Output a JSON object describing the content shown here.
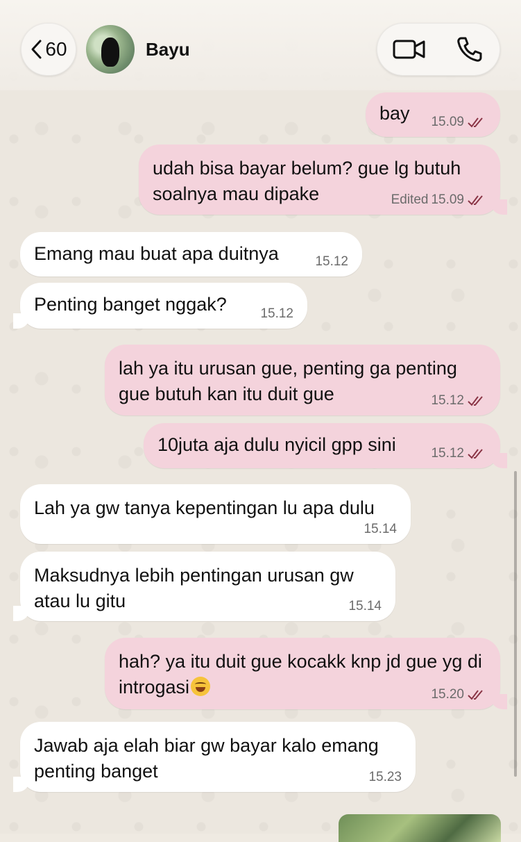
{
  "header": {
    "back_count": "60",
    "contact_name": "Bayu"
  },
  "messages": [
    {
      "dir": "out",
      "text": "bay",
      "time": "15.09",
      "edited": "",
      "status": "read"
    },
    {
      "dir": "out",
      "text": "udah bisa bayar belum? gue lg butuh soalnya mau dipake",
      "time": "15.09",
      "edited": "Edited",
      "status": "read"
    },
    {
      "dir": "in",
      "text": "Emang mau buat apa duitnya",
      "time": "15.12"
    },
    {
      "dir": "in",
      "text": "Penting banget nggak?",
      "time": "15.12"
    },
    {
      "dir": "out",
      "text": "lah ya itu urusan gue, penting ga penting gue butuh kan itu duit gue",
      "time": "15.12",
      "status": "read"
    },
    {
      "dir": "out",
      "text": "10juta aja dulu nyicil gpp sini",
      "time": "15.12",
      "status": "read"
    },
    {
      "dir": "in",
      "text": "Lah ya gw tanya kepentingan lu apa dulu",
      "time": "15.14"
    },
    {
      "dir": "in",
      "text": "Maksudnya lebih pentingan urusan gw atau lu gitu",
      "time": "15.14"
    },
    {
      "dir": "out",
      "text": "hah? ya itu duit gue kocakk knp jd gue yg di introgasi",
      "emoji": "rolling-on-floor-laughing",
      "time": "15.20",
      "status": "read"
    },
    {
      "dir": "in",
      "text": "Jawab aja elah biar gw bayar kalo emang penting banget",
      "time": "15.23"
    }
  ],
  "colors": {
    "outgoing_bubble": "#f4d3dc",
    "incoming_bubble": "#ffffff",
    "read_ticks": "#8a3546"
  }
}
